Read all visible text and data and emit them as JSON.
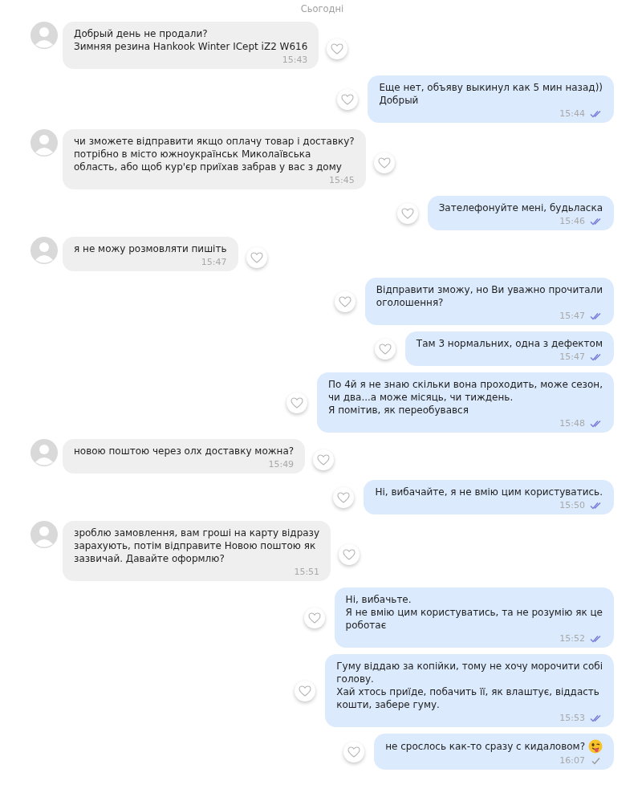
{
  "date_label": "Сьогодні",
  "messages": [
    {
      "kind": "incoming",
      "lines": [
        "Добрый день не продали?",
        "Зимняя резина Hankook Winter ICept iZ2 W616"
      ],
      "time": "15:43"
    },
    {
      "kind": "outgoing",
      "lines": [
        "Еще нет, объяву выкинул как 5 мин назад))",
        "Добрый"
      ],
      "time": "15:44",
      "read": true,
      "emoji": false
    },
    {
      "kind": "incoming",
      "lines": [
        "чи зможете відправити якщо оплачу товар і доставку?",
        "потрібно в місто южноукраїнськ Миколаївська",
        "область, або щоб кур'єр приїхав забрав у вас з дому"
      ],
      "time": "15:45"
    },
    {
      "kind": "outgoing",
      "lines": [
        "Зателефонуйте мені, будьласка"
      ],
      "time": "15:46",
      "read": true,
      "emoji": false
    },
    {
      "kind": "incoming",
      "lines": [
        "я не можу розмовляти пишіть"
      ],
      "time": "15:47"
    },
    {
      "kind": "outgoing",
      "lines": [
        "Відправити зможу, но Ви уважно прочитали",
        "оголошення?"
      ],
      "time": "15:47",
      "read": true,
      "emoji": false
    },
    {
      "kind": "outgoing",
      "lines": [
        "Там 3 нормальних, одна з дефектом"
      ],
      "time": "15:47",
      "read": true,
      "emoji": false
    },
    {
      "kind": "outgoing",
      "lines": [
        "По 4й я не знаю скільки вона проходить, може сезон,",
        "чи два...а може місяць, чи тиждень.",
        "Я помітив, як переобувався"
      ],
      "time": "15:48",
      "read": true,
      "emoji": false
    },
    {
      "kind": "incoming",
      "lines": [
        "новою поштою через олх доставку можна?"
      ],
      "time": "15:49"
    },
    {
      "kind": "outgoing",
      "lines": [
        "Ні, вибачайте, я не вмію цим користуватись."
      ],
      "time": "15:50",
      "read": true,
      "emoji": false
    },
    {
      "kind": "incoming",
      "lines": [
        "зроблю замовлення, вам гроші на карту відразу",
        "зарахують, потім відправите Новою поштою як",
        "зазвичай. Давайте оформлю?"
      ],
      "time": "15:51"
    },
    {
      "kind": "outgoing",
      "lines": [
        "Ні, вибачьте.",
        "Я не вмію цим користуватись, та не розумію як це",
        "роботає"
      ],
      "time": "15:52",
      "read": true,
      "emoji": false
    },
    {
      "kind": "outgoing",
      "lines": [
        "Гуму віддаю за копійки, тому не хочу морочити собі",
        "голову.",
        "Хай хтось приїде, побачить її, як влаштує, віддасть",
        "кошти, забере гуму."
      ],
      "time": "15:53",
      "read": true,
      "emoji": false
    },
    {
      "kind": "outgoing",
      "lines": [
        "не срослось как-то сразу с кидаловом?"
      ],
      "time": "16:07",
      "read": false,
      "emoji": true
    }
  ]
}
